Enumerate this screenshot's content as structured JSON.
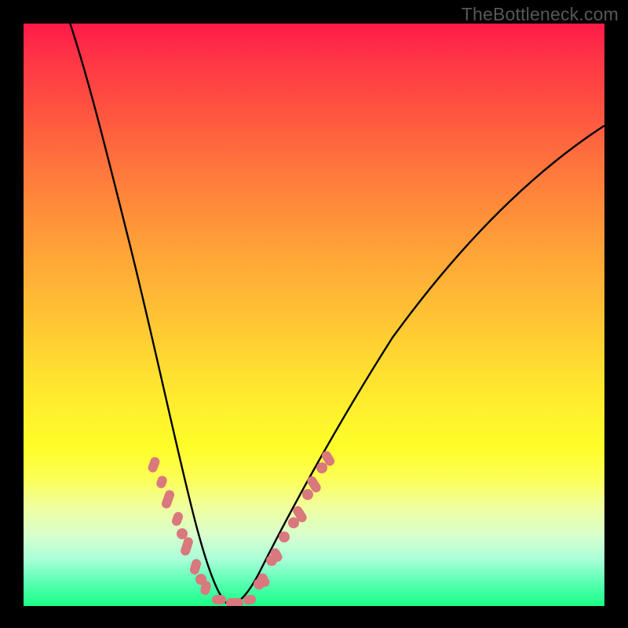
{
  "watermark": "TheBottleneck.com",
  "colors": {
    "frame": "#000000",
    "curve": "#000000",
    "marker": "#d9787d",
    "gradient_top": "#ff1a49",
    "gradient_bottom": "#1aff85"
  },
  "chart_data": {
    "type": "line",
    "title": "",
    "xlabel": "",
    "ylabel": "",
    "xlim": [
      0,
      100
    ],
    "ylim": [
      0,
      100
    ],
    "grid": false,
    "legend": false,
    "description": "V-shaped bottleneck curve over a vertical red-to-green gradient; minimum (optimal match) at x≈34. No axis ticks or numeric labels are visible.",
    "series": [
      {
        "name": "bottleneck-curve",
        "x": [
          0,
          3,
          6,
          9,
          12,
          15,
          18,
          21,
          24,
          27,
          30,
          33,
          34,
          36,
          39,
          42,
          46,
          52,
          58,
          66,
          76,
          88,
          100
        ],
        "y": [
          108,
          95,
          82,
          70,
          58,
          47,
          37,
          28,
          20,
          13,
          7,
          2,
          1,
          2,
          6,
          11,
          18,
          27,
          35,
          45,
          56,
          67,
          77
        ]
      }
    ],
    "markers": {
      "name": "highlight-dots",
      "x": [
        22,
        23,
        24,
        25,
        26,
        27,
        28,
        29,
        30,
        31,
        33,
        34,
        35,
        37,
        38,
        39,
        40,
        41,
        42,
        43,
        44,
        45
      ],
      "y": [
        25,
        23,
        20,
        17,
        15,
        12,
        10,
        8,
        6,
        4,
        2,
        1,
        1,
        3,
        5,
        7,
        9,
        11,
        13,
        15,
        17,
        19
      ]
    }
  }
}
